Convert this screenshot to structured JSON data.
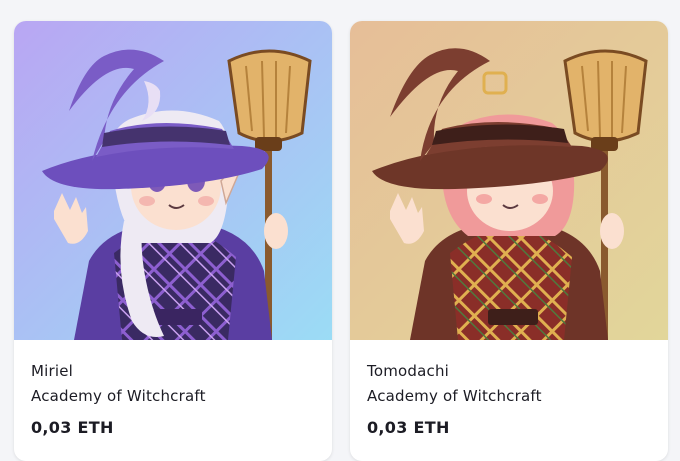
{
  "listings": [
    {
      "name": "Miriel",
      "collection": "Academy of Witchcraft",
      "price": "0,03 ETH",
      "artwork": "purple-witch-illustration",
      "colors": {
        "bg_top": "#b8a8f2",
        "bg_bottom": "#9ad8f4",
        "hat": "#7a5cc0",
        "robe": "#6a4aa8",
        "hair": "#eeeaf4"
      }
    },
    {
      "name": "Tomodachi",
      "collection": "Academy of Witchcraft",
      "price": "0,03 ETH",
      "artwork": "red-witch-illustration",
      "colors": {
        "bg_top": "#e6c09a",
        "bg_bottom": "#e4d49a",
        "hat": "#7a3e32",
        "robe": "#6e3428",
        "hair": "#f0a0a0"
      }
    }
  ]
}
